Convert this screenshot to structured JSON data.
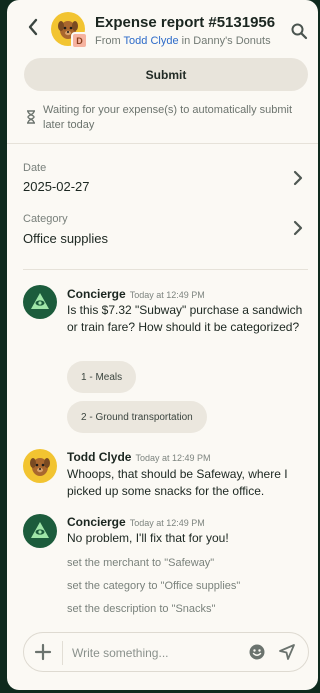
{
  "header": {
    "title": "Expense report #5131956",
    "subtitle_prefix": "From ",
    "subtitle_user": "Todd Clyde",
    "subtitle_middle": " in ",
    "subtitle_workspace": "Danny's Donuts",
    "badge_letter": "D",
    "icons": {
      "back": "chevron-left-icon",
      "search": "search-icon"
    }
  },
  "submit": {
    "label": "Submit"
  },
  "status": {
    "text": "Waiting for your expense(s) to automatically submit later today",
    "icon": "hourglass-icon"
  },
  "fields": [
    {
      "label": "Date",
      "value": "2025-02-27"
    },
    {
      "label": "Category",
      "value": "Office supplies"
    }
  ],
  "messages": [
    {
      "author": "Concierge",
      "time": "Today at 12:49 PM",
      "text": "Is this $7.32 \"Subway\" purchase a sandwich or train fare?  How should it be categorized?",
      "options": [
        "1 - Meals",
        "2 - Ground transportation"
      ]
    },
    {
      "author": "Todd Clyde",
      "time": "Today at 12:49 PM",
      "text": "Whoops, that should be Safeway, where I picked up some snacks for the office."
    },
    {
      "author": "Concierge",
      "time": "Today at 12:49 PM",
      "text": "No problem, I'll fix that for you!",
      "actions": [
        "set the merchant to \"Safeway\"",
        "set the category to \"Office supplies\"",
        "set the description to \"Snacks\""
      ]
    }
  ],
  "composer": {
    "placeholder": "Write something...",
    "value": ""
  },
  "colors": {
    "accent_link": "#2d6bc9",
    "concierge": "#1c5c3c",
    "avatar_yellow": "#f2c431",
    "background_dark": "#0f2a1e"
  }
}
